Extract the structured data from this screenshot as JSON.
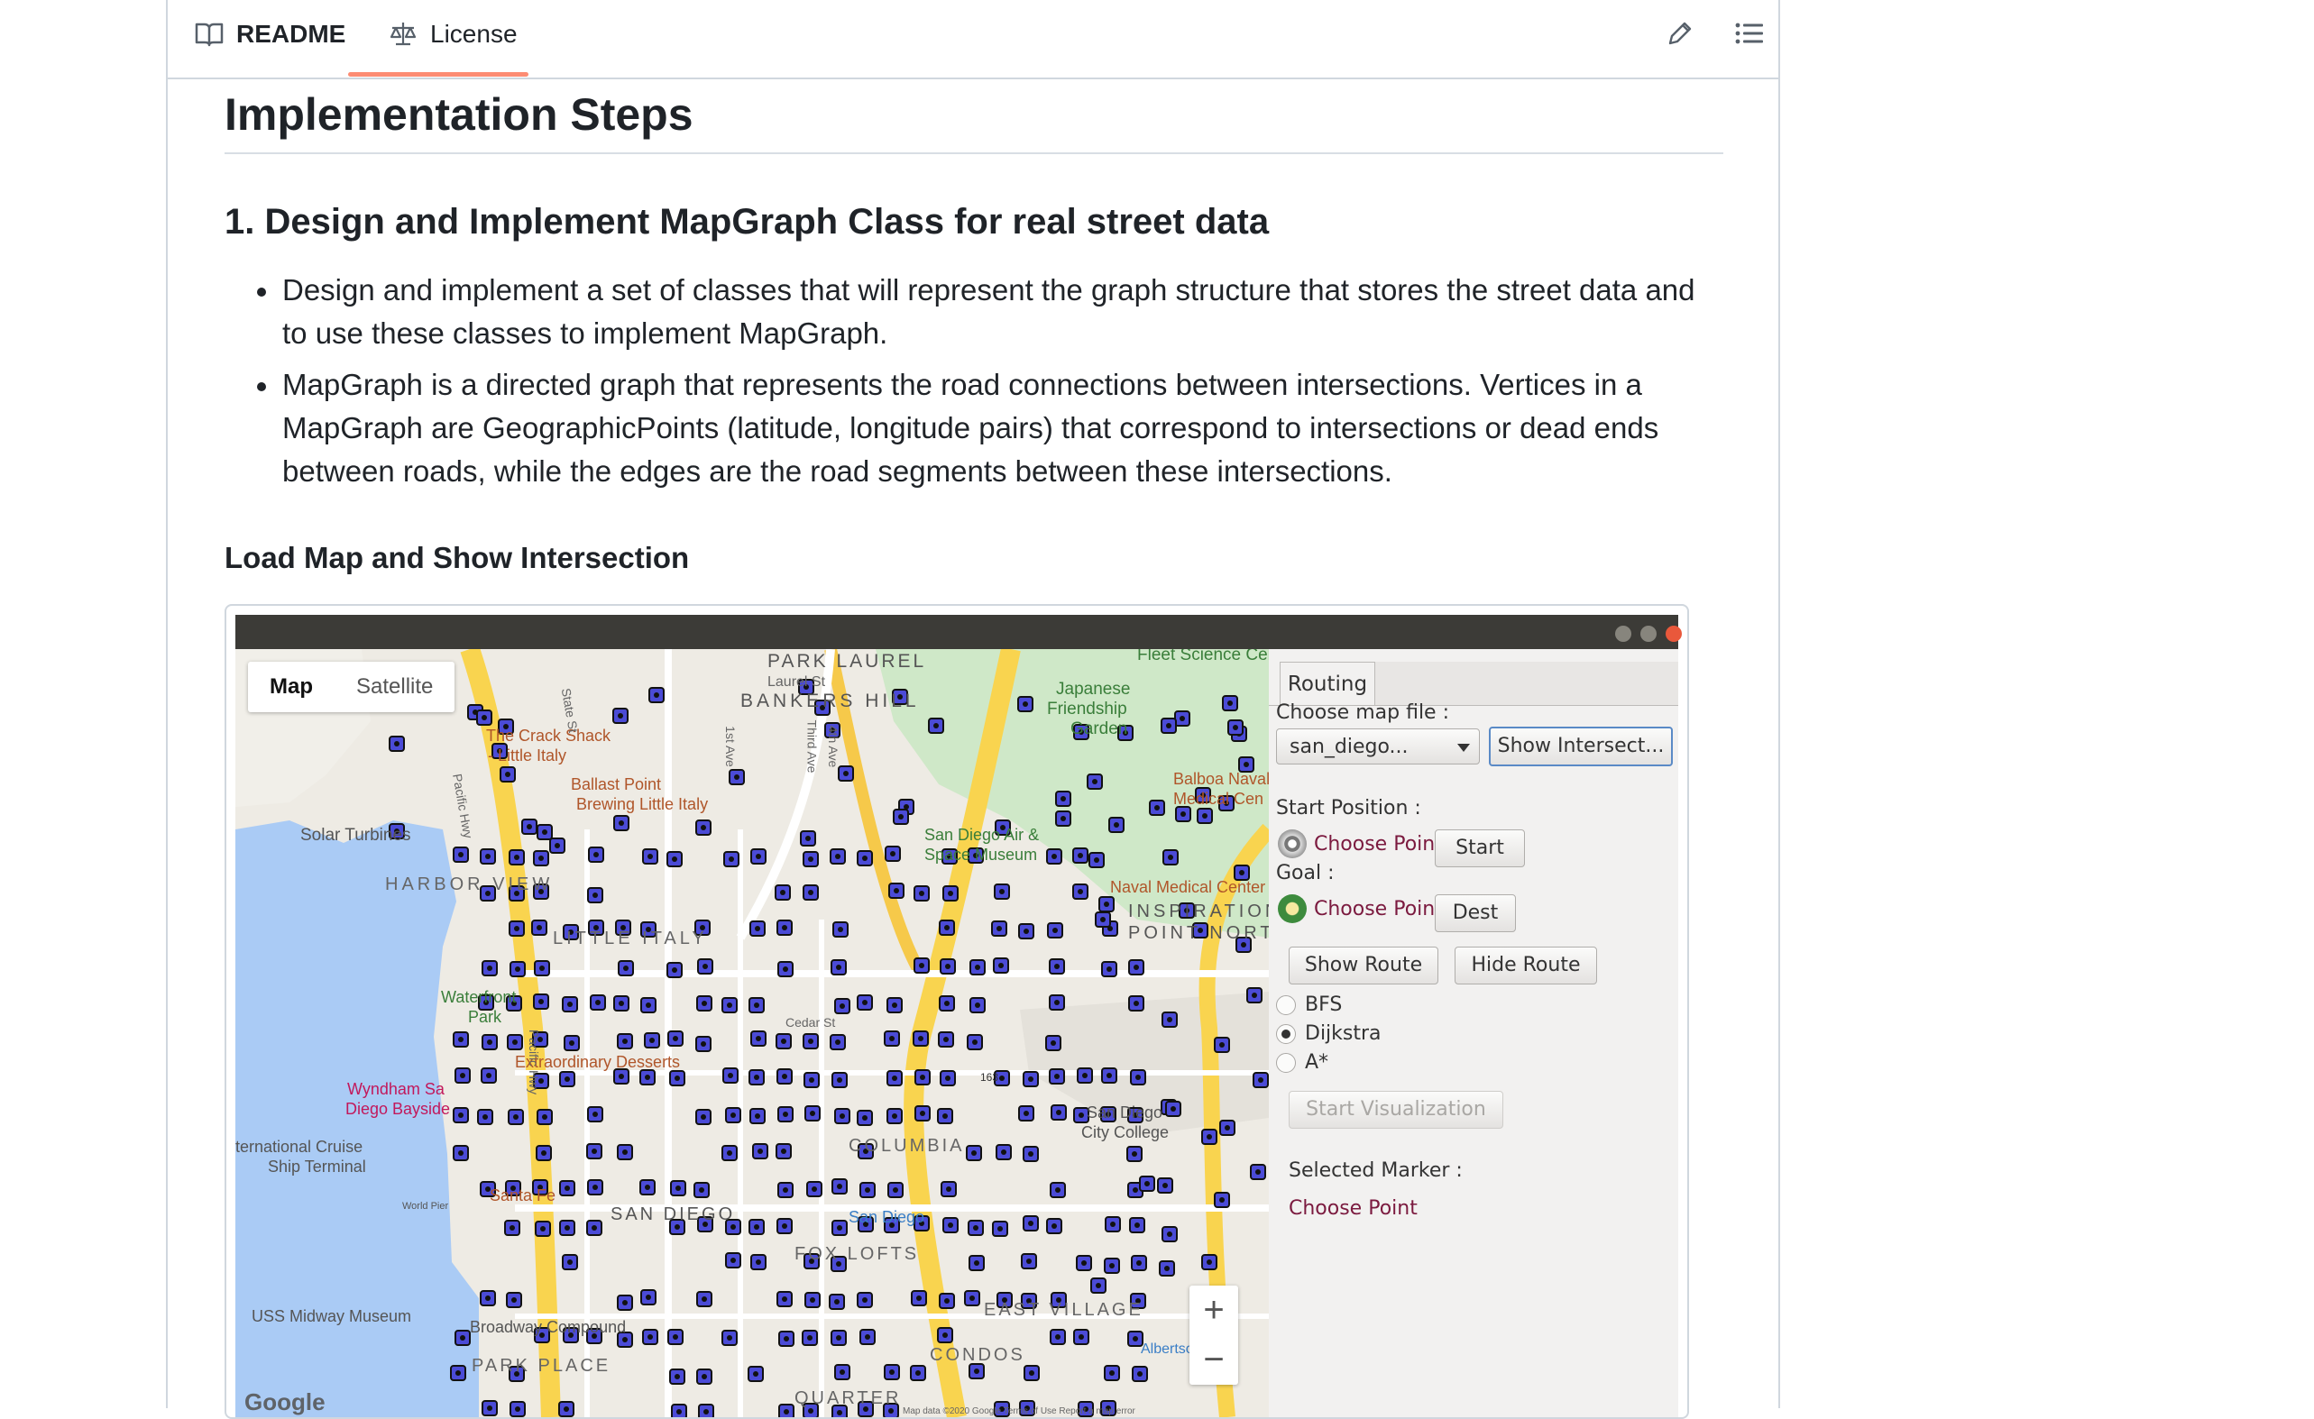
{
  "tabs": {
    "readme": "README",
    "license": "License"
  },
  "toolbar": {
    "edit_icon": "pencil-icon",
    "outline_icon": "list-icon"
  },
  "article": {
    "h2": "Implementation Steps",
    "h3": "1. Design and Implement MapGraph Class for real street data",
    "bullets": [
      "Design and implement a set of classes that will represent the graph structure that stores the street data and to use these classes to implement MapGraph.",
      "MapGraph is a directed graph that represents the road connections between intersections. Vertices in a MapGraph are GeographicPoints (latitude, longitude pairs) that correspond to intersections or dead ends between roads, while the edges are the road segments between these intersections."
    ],
    "h4": "Load Map and Show Intersection"
  },
  "screenshot": {
    "map": {
      "type_map": "Map",
      "type_satellite": "Satellite",
      "zoom_in": "+",
      "zoom_out": "−",
      "google": "Google",
      "attribution": "Map data ©2020 Google   Terms of Use   Report a map error",
      "labels": {
        "park_laurel": "PARK LAUREL",
        "bankers_hill": "BANKERS HILL",
        "laurel_st": "Laurel St",
        "fleet": "Fleet Science Cente",
        "japanese": "Japanese",
        "friendship": "Friendship",
        "garden": "Garden",
        "crack_shack": "The Crack Shack",
        "little_italy_a": "- Little Italy",
        "ballast": "Ballast Point",
        "brewing": "Brewing Little Italy",
        "solar": "Solar Turbines",
        "balboa": "Balboa Naval",
        "medical": "Medical Cen",
        "harbor": "HARBOR VIEW",
        "little_italy": "LITTLE ITALY",
        "sd_air": "San Diego Air &",
        "space": "Space Museum",
        "naval_med": "Naval Medical Center",
        "inspiration": "INSPIRATION",
        "point_north": "POINT NORTH",
        "waterfront": "Waterfront",
        "park": "Park",
        "extraordinary": "Extraordinary Desserts",
        "wyndham": "Wyndham Sa",
        "diego_bay": "Diego Bayside",
        "cruise": "ternational Cruise",
        "ship_terminal": "Ship Terminal",
        "sd_city": "San Diego",
        "city_college": "City College",
        "santa_fe": "Santa Fe",
        "san_diego_mid": "SAN DIEGO",
        "fox_lofts": "FOX LOFTS",
        "east_village": "EAST VILLAGE",
        "condos": "CONDOS",
        "midway": "USS Midway Museum",
        "broadway": "Broadway Compound",
        "park_place": "PARK PLACE",
        "quarter": "QUARTER",
        "world_pier": "World Pier",
        "cedar": "Cedar St",
        "pacific_hwy": "Pacific Hwy",
        "pacific_hwy2": "Pacific Hwy",
        "state_st": "State St",
        "first_ave": "1st Ave",
        "third_ave": "Third Ave",
        "fourth_ave": "4th Ave",
        "sd_station": "San Diego",
        "albertsons": "Albertson",
        "balboa_park_num": "163",
        "col": "COLUMBIA"
      }
    },
    "panel": {
      "tab": "Routing",
      "choose_map": "Choose map file :",
      "map_file": "san_diego...",
      "show_intersections": "Show Intersect...",
      "start_position": "Start Position :",
      "start_choose": "Choose Point",
      "start_button": "Start",
      "goal": "Goal :",
      "goal_choose": "Choose Point",
      "dest_button": "Dest",
      "show_route": "Show Route",
      "hide_route": "Hide Route",
      "algorithms": [
        "BFS",
        "Dijkstra",
        "A*"
      ],
      "selected_algorithm": "Dijkstra",
      "start_visualization": "Start Visualization",
      "selected_marker_label": "Selected Marker :",
      "selected_marker_value": "Choose Point"
    }
  },
  "colors": {
    "tab_underline": "#fd8c73",
    "marker_fill": "#4b4bd6",
    "water": "#aacbf5",
    "park": "#cfe8c8",
    "highway": "#f9d44f",
    "link_maroon": "#7b1a3f"
  }
}
